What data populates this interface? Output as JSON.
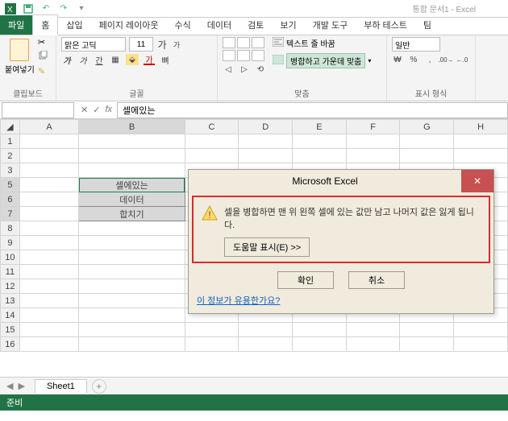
{
  "window": {
    "title": "통합 문서1 - Excel"
  },
  "qat": {
    "save": "save-icon",
    "undo": "undo-icon",
    "redo": "redo-icon"
  },
  "tabs": {
    "file": "파일",
    "home": "홈",
    "insert": "삽입",
    "pagelayout": "페이지 레이아웃",
    "formulas": "수식",
    "data": "데이터",
    "review": "검토",
    "view": "보기",
    "developer": "개발 도구",
    "loadtest": "부하 테스트",
    "team": "팀"
  },
  "ribbon": {
    "clipboard": {
      "label": "클립보드",
      "paste": "붙여넣기"
    },
    "font": {
      "label": "글꼴",
      "name": "맑은 고딕",
      "size": "11",
      "grow": "가",
      "shrink": "가"
    },
    "align": {
      "label": "맞춤",
      "wrap": "텍스트 줄 바꿈",
      "merge": "병합하고 가운데 맞춤"
    },
    "number": {
      "label": "표시 형식",
      "format": "일반"
    }
  },
  "formula": {
    "namebox": "",
    "fx": "fx",
    "value": "셀에있는"
  },
  "columns": [
    "A",
    "B",
    "C",
    "D",
    "E",
    "F",
    "G",
    "H"
  ],
  "rows": [
    "1",
    "2",
    "3",
    "5",
    "6",
    "7",
    "8",
    "9",
    "10",
    "11",
    "12",
    "13",
    "14",
    "15",
    "16"
  ],
  "cells": {
    "B5": "셀에있는",
    "B6": "데이터",
    "B7": "합치기"
  },
  "dialog": {
    "title": "Microsoft Excel",
    "message": "셀을 병합하면 맨 위 왼쪽 셀에 있는 값만 남고 나머지 값은 잃게 됩니다.",
    "help": "도움말 표시(E) >>",
    "ok": "확인",
    "cancel": "취소",
    "info_link": "이 정보가 유용한가요?"
  },
  "sheettabs": {
    "sheet1": "Sheet1",
    "add": "+"
  },
  "status": {
    "mode": "준비"
  }
}
